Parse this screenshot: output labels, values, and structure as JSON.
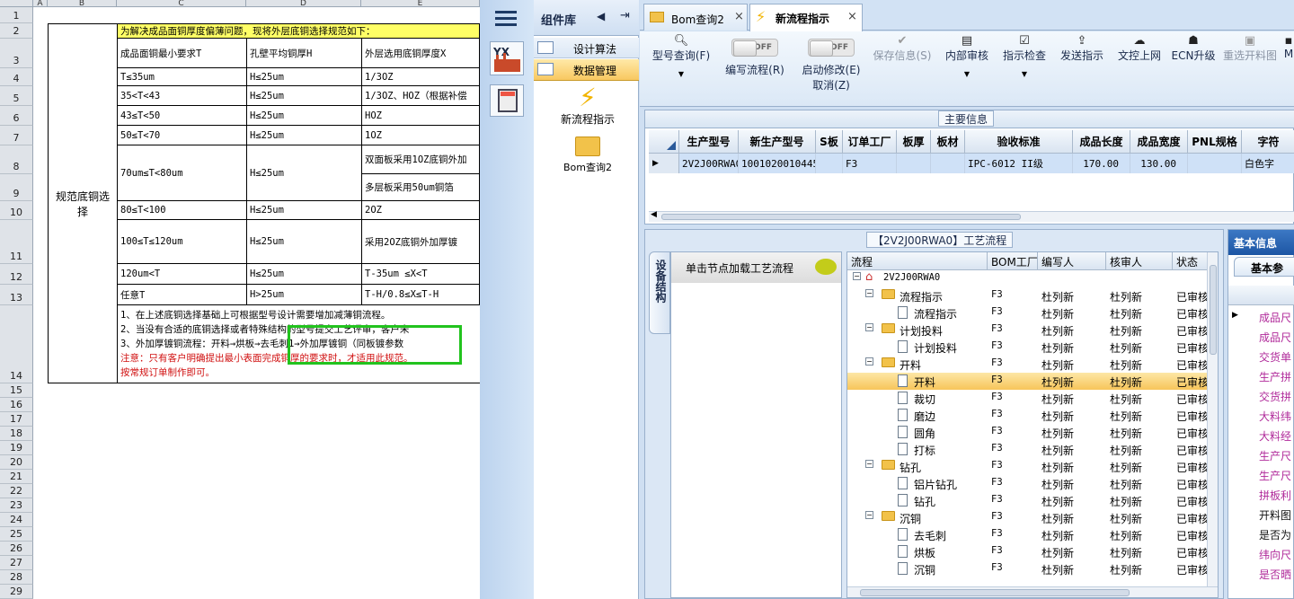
{
  "sheet": {
    "columns": [
      "A",
      "B",
      "C",
      "D",
      "E"
    ],
    "rows": [
      "1",
      "2",
      "3",
      "4",
      "5",
      "6",
      "7",
      "8",
      "9",
      "10",
      "11",
      "12",
      "13",
      "14",
      "15",
      "16",
      "17",
      "18",
      "19",
      "20",
      "21",
      "22",
      "23",
      "24",
      "25",
      "26",
      "27",
      "28",
      "29"
    ],
    "merged_label": "规范底铜选择",
    "title": "为解决成品面铜厚度偏薄问题，现将外层底铜选择规范如下：",
    "headers": [
      "成品面铜最小要求T",
      "孔壁平均铜厚H",
      "外层选用底铜厚度X"
    ],
    "data_rows": [
      [
        "T≤35um",
        "H≤25um",
        "1/3OZ"
      ],
      [
        "35<T<43",
        "H≤25um",
        "1/3OZ、HOZ（根据补偿"
      ],
      [
        "43≤T<50",
        "H≤25um",
        "HOZ"
      ],
      [
        "50≤T<70",
        "H≤25um",
        "1OZ"
      ],
      [
        "70um≤T<80um",
        "H≤25um",
        "双面板采用1OZ底铜外加"
      ],
      [
        "",
        "",
        "多层板采用50um铜箔"
      ],
      [
        "80≤T<100",
        "H≤25um",
        "2OZ"
      ],
      [
        "100≤T≤120um",
        "H≤25um",
        "采用2OZ底铜外加厚镀"
      ],
      [
        "120um<T",
        "H≤25um",
        "T-35um ≤X<T"
      ],
      [
        "任意T",
        "H>25um",
        "T-H/0.8≤X≤T-H"
      ]
    ],
    "notes": [
      "1、在上述底铜选择基础上可根据型号设计需要增加减薄铜流程。",
      "2、当没有合适的底铜选择或者特殊结构的型号提交工艺评审，客户未",
      "3、外加厚镀铜流程：开料→烘板→去毛刺1→外加厚镀铜（同板镀参数",
      "注意：只有客户明确提出最小表面完成铜厚的要求时，才适用此规范。",
      "按常规订单制作即可。"
    ]
  },
  "sidebar": {
    "title": "组件库",
    "items": [
      "设计算法",
      "数据管理"
    ],
    "icons": [
      {
        "label": "新流程指示"
      },
      {
        "label": "Bom查询2"
      }
    ]
  },
  "tabs": [
    {
      "label": "Bom查询2"
    },
    {
      "label": "新流程指示"
    }
  ],
  "toolbar": {
    "buttons": [
      {
        "label": "型号查询(F)"
      },
      {
        "label": "编写流程(R)"
      },
      {
        "label": "启动修改(E)"
      },
      {
        "label": "取消(Z)"
      },
      {
        "label": "保存信息(S)"
      },
      {
        "label": "内部审核"
      },
      {
        "label": "指示检查"
      },
      {
        "label": "发送指示"
      },
      {
        "label": "文控上网"
      },
      {
        "label": "ECN升级"
      },
      {
        "label": "重选开料图"
      },
      {
        "label": "M"
      }
    ],
    "toggle_text": "OFF"
  },
  "main_info": {
    "title": "主要信息",
    "columns": [
      "生产型号",
      "新生产型号",
      "S板",
      "订单工厂",
      "板厚",
      "板材",
      "验收标准",
      "成品长度",
      "成品宽度",
      "PNL规格",
      "字符"
    ],
    "row": [
      "2V2J00RWA0",
      "10010200104458",
      "",
      "F3",
      "",
      "",
      "IPC-6012 II级",
      "170.00",
      "130.00",
      "",
      "白色字"
    ]
  },
  "process": {
    "title": "【2V2J00RWA0】工艺流程",
    "vertical_tab": "设备结构",
    "hint": "单击节点加载工艺流程",
    "columns": [
      "流程",
      "BOM工厂",
      "编写人",
      "核审人",
      "状态"
    ],
    "root": "2V2J00RWA0",
    "nodes": [
      {
        "label": "流程指示",
        "folder": true,
        "f": "F3",
        "w": "杜列新",
        "r": "杜列新",
        "s": "已审核"
      },
      {
        "label": "流程指示",
        "folder": false,
        "f": "F3",
        "w": "杜列新",
        "r": "杜列新",
        "s": "已审核"
      },
      {
        "label": "计划投料",
        "folder": true,
        "f": "F3",
        "w": "杜列新",
        "r": "杜列新",
        "s": "已审核"
      },
      {
        "label": "计划投料",
        "folder": false,
        "f": "F3",
        "w": "杜列新",
        "r": "杜列新",
        "s": "已审核"
      },
      {
        "label": "开料",
        "folder": true,
        "f": "F3",
        "w": "杜列新",
        "r": "杜列新",
        "s": "已审核"
      },
      {
        "label": "开料",
        "folder": false,
        "f": "F3",
        "w": "杜列新",
        "r": "杜列新",
        "s": "已审核"
      },
      {
        "label": "裁切",
        "folder": false,
        "f": "F3",
        "w": "杜列新",
        "r": "杜列新",
        "s": "已审核"
      },
      {
        "label": "磨边",
        "folder": false,
        "f": "F3",
        "w": "杜列新",
        "r": "杜列新",
        "s": "已审核"
      },
      {
        "label": "圆角",
        "folder": false,
        "f": "F3",
        "w": "杜列新",
        "r": "杜列新",
        "s": "已审核"
      },
      {
        "label": "打标",
        "folder": false,
        "f": "F3",
        "w": "杜列新",
        "r": "杜列新",
        "s": "已审核"
      },
      {
        "label": "钻孔",
        "folder": true,
        "f": "F3",
        "w": "杜列新",
        "r": "杜列新",
        "s": "已审核"
      },
      {
        "label": "铝片钻孔",
        "folder": false,
        "f": "F3",
        "w": "杜列新",
        "r": "杜列新",
        "s": "已审核"
      },
      {
        "label": "钻孔",
        "folder": false,
        "f": "F3",
        "w": "杜列新",
        "r": "杜列新",
        "s": "已审核"
      },
      {
        "label": "沉铜",
        "folder": true,
        "f": "F3",
        "w": "杜列新",
        "r": "杜列新",
        "s": "已审核"
      },
      {
        "label": "去毛刺",
        "folder": false,
        "f": "F3",
        "w": "杜列新",
        "r": "杜列新",
        "s": "已审核"
      },
      {
        "label": "烘板",
        "folder": false,
        "f": "F3",
        "w": "杜列新",
        "r": "杜列新",
        "s": "已审核"
      },
      {
        "label": "沉铜",
        "folder": false,
        "f": "F3",
        "w": "杜列新",
        "r": "杜列新",
        "s": "已审核"
      }
    ]
  },
  "basic_info": {
    "title": "基本信息",
    "subtab": "基本参",
    "items": [
      "成品尺",
      "成品尺",
      "交货单",
      "生产拼",
      "交货拼",
      "大料纬",
      "大料经",
      "生产尺",
      "生产尺",
      "拼板利",
      "开料图",
      "是否为",
      "纬向尺",
      "是否晒"
    ]
  },
  "colors": {
    "accent": "#ffd45c",
    "selection": "#fbd67a",
    "highlight_box": "#22c31e"
  }
}
